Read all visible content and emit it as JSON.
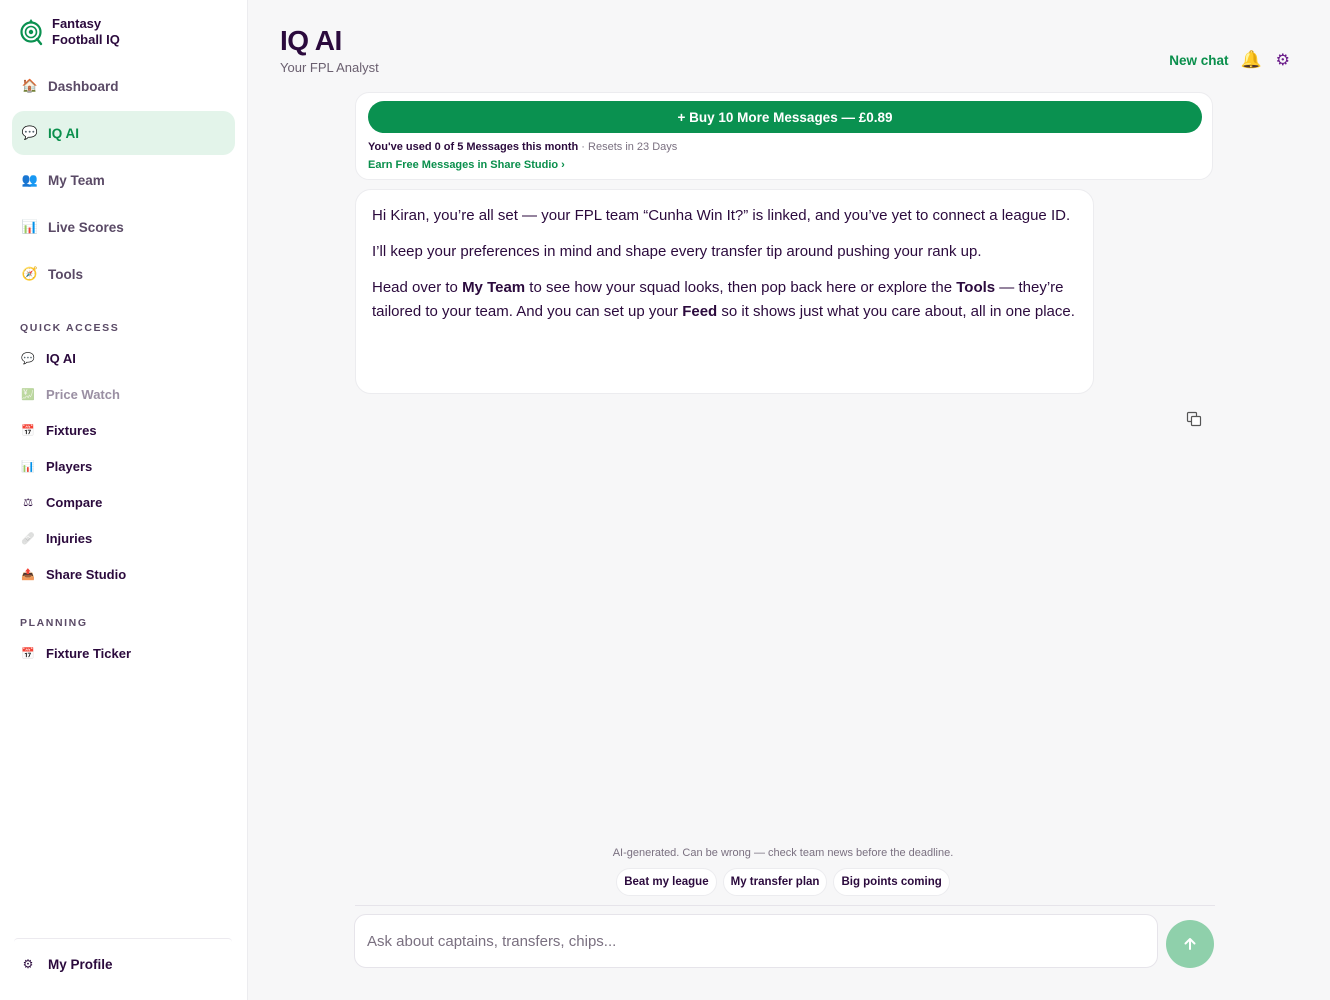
{
  "brand": {
    "line1": "Fantasy",
    "line2": "Football IQ"
  },
  "nav": {
    "items": [
      {
        "label": "Dashboard",
        "icon": "house-icon",
        "glyph": "🏠",
        "active": false
      },
      {
        "label": "IQ AI",
        "icon": "chat-icon",
        "glyph": "💬",
        "active": true
      },
      {
        "label": "My Team",
        "icon": "people-icon",
        "glyph": "👥",
        "active": false
      },
      {
        "label": "Live Scores",
        "icon": "bar-chart-icon",
        "glyph": "📊",
        "active": false
      },
      {
        "label": "Tools",
        "icon": "compass-icon",
        "glyph": "🧭",
        "active": false
      }
    ]
  },
  "quick_access": {
    "title": "QUICK ACCESS",
    "items": [
      {
        "label": "IQ AI",
        "icon": "chat-icon",
        "glyph": "💬"
      },
      {
        "label": "Price Watch",
        "icon": "chart-icon",
        "glyph": "💹"
      },
      {
        "label": "Fixtures",
        "icon": "calendar-icon",
        "glyph": "📅"
      },
      {
        "label": "Players",
        "icon": "bar-chart-icon",
        "glyph": "📊"
      },
      {
        "label": "Compare",
        "icon": "scales-icon",
        "glyph": "⚖"
      },
      {
        "label": "Injuries",
        "icon": "bandage-icon",
        "glyph": "🩹"
      },
      {
        "label": "Share Studio",
        "icon": "share-icon",
        "glyph": "📤"
      }
    ]
  },
  "planning": {
    "title": "PLANNING",
    "items": [
      {
        "label": "Fixture Ticker",
        "icon": "calendar-icon",
        "glyph": "📅"
      }
    ]
  },
  "profile": {
    "label": "My Profile",
    "icon": "gear-icon",
    "glyph": "⚙"
  },
  "header": {
    "title": "IQ AI",
    "subtitle": "Your FPL Analyst",
    "new_chat": "New chat",
    "bell_glyph": "🔔",
    "gear_glyph": "⚙"
  },
  "usage": {
    "buy_label": "+ Buy 10 More Messages — £0.89",
    "used_text": "You've used 0 of 5 Messages this month",
    "resets_text": " · Resets in 23 Days",
    "earn_link": "Earn Free Messages in Share Studio ›"
  },
  "message": {
    "p1": "Hi Kiran, you’re all set — your FPL team “Cunha Win It?” is linked, and you’ve yet to connect a league ID.",
    "p2": "I’ll keep your preferences in mind and shape every transfer tip around pushing your rank up.",
    "p3_a": "Head over to ",
    "p3_b": "My Team",
    "p3_c": " to see how your squad looks, then pop back here or explore the ",
    "p3_d": "Tools",
    "p3_e": " — they’re tailored to your team. And you can set up your ",
    "p3_f": "Feed",
    "p3_g": " so it shows just what you care about, all in one place."
  },
  "footer": {
    "disclaimer": "AI-generated. Can be wrong — check team news before the deadline.",
    "chips": [
      "Beat my league",
      "My transfer plan",
      "Big points coming"
    ],
    "input_placeholder": "Ask about captains, transfers, chips..."
  },
  "colors": {
    "accent": "#0a9150",
    "text": "#2b0a3d",
    "active_bg": "#e3f4ea",
    "send_bg": "#8fd0ab"
  }
}
